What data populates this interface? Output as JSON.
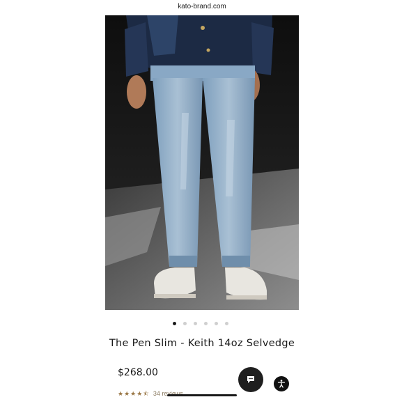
{
  "browser": {
    "url": "kato-brand.com"
  },
  "gallery": {
    "slide_count": 6,
    "active_index": 0
  },
  "product": {
    "title": "The Pen Slim - Keith 14oz Selvedge",
    "price": "$268.00",
    "rating_stars": 4.5,
    "reviews_label": "34 reviews"
  },
  "icons": {
    "chat": "chat-bubble-icon",
    "accessibility": "accessibility-icon"
  },
  "colors": {
    "star": "#9a7746",
    "chat_button": "#1f1f1f",
    "active_dot": "#1a1a1a",
    "inactive_dot": "#cfcfcf"
  }
}
